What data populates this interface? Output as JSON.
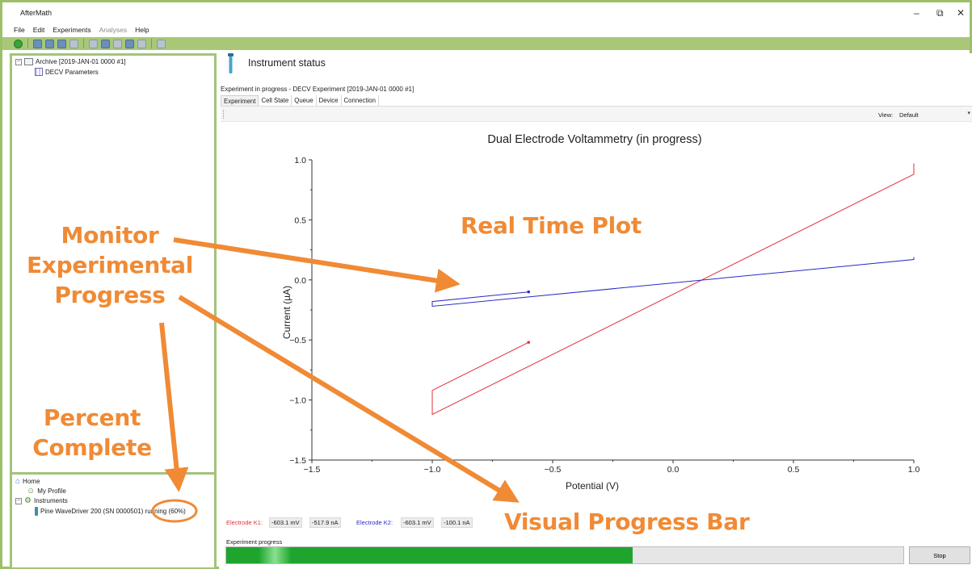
{
  "window": {
    "title": "AfterMath",
    "minimize": "–",
    "restore": "⧉",
    "close": "✕"
  },
  "menu": [
    "File",
    "Edit",
    "Experiments",
    "Analyses",
    "Help"
  ],
  "menu_disabled": [
    "Analyses"
  ],
  "toolbar_icons": [
    "start-icon",
    "open-archive-icon",
    "open-folder-icon",
    "save-icon",
    "print-icon",
    "wrench-icon",
    "layout-icon",
    "table-icon",
    "settings-icon",
    "sigma-icon",
    "clipboard-icon"
  ],
  "tree": {
    "archive_label": "Archive [2019-JAN-01 0000 #1]",
    "decv_label": "DECV Parameters"
  },
  "bottom_tree": {
    "home": "Home",
    "profile": "My Profile",
    "instruments": "Instruments",
    "device": "Pine WaveDriver 200 (SN 0000501) running (60%)"
  },
  "status": {
    "title": "Instrument status",
    "experiment_line": "Experiment in progress - DECV Experiment [2019-JAN-01 0000 #1]"
  },
  "tabs": [
    "Experiment",
    "Cell State",
    "Queue",
    "Device",
    "Connection"
  ],
  "view": {
    "label": "View:",
    "value": "Default"
  },
  "chart_data": {
    "type": "line",
    "title": "Dual Electrode Voltammetry (in progress)",
    "xlabel": "Potential (V)",
    "ylabel": "Current (µA)",
    "xlim": [
      -1.5,
      1.0
    ],
    "ylim": [
      -1.5,
      1.0
    ],
    "xticks": [
      "−1.5",
      "−1.0",
      "−0.5",
      "0.0",
      "0.5",
      "1.0"
    ],
    "yticks": [
      "1.0",
      "0.5",
      "0.0",
      "−0.5",
      "−1.0",
      "−1.5"
    ],
    "series": [
      {
        "name": "Electrode K1",
        "color": "#e0303a",
        "x": [
          -0.6,
          -1.0,
          -1.0,
          1.0,
          1.0
        ],
        "y": [
          -0.52,
          -0.92,
          -1.12,
          0.88,
          0.97
        ]
      },
      {
        "name": "Electrode K2",
        "color": "#2a2ac8",
        "x": [
          -0.6,
          -1.0,
          -1.0,
          1.0,
          1.0
        ],
        "y": [
          -0.1,
          -0.18,
          -0.22,
          0.17,
          0.19
        ]
      }
    ]
  },
  "readouts": {
    "k1_label": "Electrode K1:",
    "k1_potential": "-603.1 mV",
    "k1_current": "-517.9 nA",
    "k2_label": "Electrode K2:",
    "k2_potential": "-603.1 mV",
    "k2_current": "-100.1 nA"
  },
  "progress": {
    "label": "Experiment progress",
    "fraction": 0.6,
    "stop_label": "Stop"
  },
  "colors": {
    "accent": "#a3c37a",
    "progress": "#1fa52e",
    "annotation": "#f08a35"
  },
  "annotations": {
    "real_time_plot": "Real Time Plot",
    "monitor": [
      "Monitor",
      "Experimental",
      "Progress"
    ],
    "percent": [
      "Percent",
      "Complete"
    ],
    "progress_bar": "Visual Progress Bar"
  }
}
